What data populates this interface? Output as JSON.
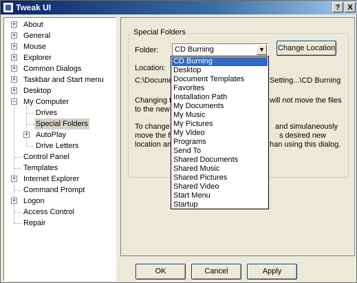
{
  "window": {
    "title": "Tweak UI",
    "help_label": "?",
    "close_label": "X"
  },
  "tree": {
    "items": [
      {
        "label": "About"
      },
      {
        "label": "General"
      },
      {
        "label": "Mouse"
      },
      {
        "label": "Explorer"
      },
      {
        "label": "Common Dialogs"
      },
      {
        "label": "Taskbar and Start menu"
      },
      {
        "label": "Desktop"
      },
      {
        "label": "My Computer"
      },
      {
        "label": "Drives"
      },
      {
        "label": "Special Folders"
      },
      {
        "label": "AutoPlay"
      },
      {
        "label": "Drive Letters"
      },
      {
        "label": "Control Panel"
      },
      {
        "label": "Templates"
      },
      {
        "label": "Internet Explorer"
      },
      {
        "label": "Command Prompt"
      },
      {
        "label": "Logon"
      },
      {
        "label": "Access Control"
      },
      {
        "label": "Repair"
      }
    ],
    "expand_plus": "+",
    "expand_minus": "−"
  },
  "special_folders": {
    "group_title": "Special Folders",
    "folder_label": "Folder:",
    "folder_value": "CD Burning",
    "change_location_label": "Change Location",
    "location_label": "Location:",
    "location_start": "C:\\Docume",
    "location_end": "Setting...\\CD Burning",
    "para1_line1_start": "Changing t",
    "para1_line1_end": "will not move the files",
    "para1_line2": "to the new",
    "para2_line1_start": "To change",
    "para2_line1_end": "and simulaneously",
    "para2_line2_start": "move the f",
    "para2_line2_end": "s desired new",
    "para2_line3_start": "location and",
    "para2_line3_end": "han using this dialog.",
    "dropdown_arrow": "▼",
    "dropdown_items": [
      "CD Burning",
      "Desktop",
      "Document Templates",
      "Favorites",
      "Installation Path",
      "My Documents",
      "My Music",
      "My Pictures",
      "My Video",
      "Programs",
      "Send To",
      "Shared Documents",
      "Shared Music",
      "Shared Pictures",
      "Shared Video",
      "Start Menu",
      "Startup"
    ]
  },
  "buttons": {
    "ok": "OK",
    "cancel": "Cancel",
    "apply": "Apply"
  }
}
